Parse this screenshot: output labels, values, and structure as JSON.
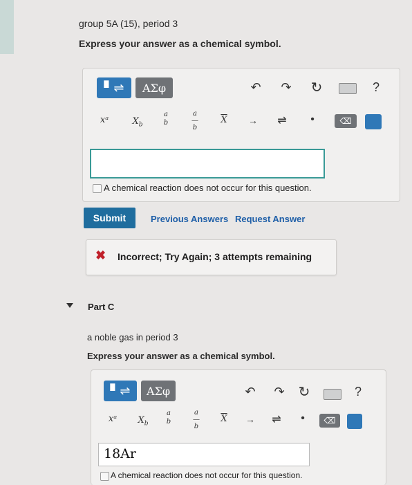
{
  "partB": {
    "prompt": "group 5A (15), period 3",
    "instruction": "Express your answer as a chemical symbol.",
    "toolbar": {
      "greek_label": "ΑΣφ",
      "help_label": "?",
      "symbols": [
        "xᵃ",
        "x_b",
        "a/b",
        "a/b",
        "x̄",
        "→",
        "⇌",
        "•"
      ]
    },
    "answer_value": "",
    "no_reaction_label": "A chemical reaction does not occur for this question.",
    "submit_label": "Submit",
    "previous_answers_label": "Previous Answers",
    "request_answer_label": "Request Answer",
    "feedback_text": "Incorrect; Try Again; 3 attempts remaining"
  },
  "partC": {
    "title": "Part C",
    "prompt": "a noble gas in period 3",
    "instruction": "Express your answer as a chemical symbol.",
    "toolbar": {
      "greek_label": "ΑΣφ",
      "help_label": "?"
    },
    "answer_value": "18Ar",
    "no_reaction_label": "A chemical reaction does not occur for this question."
  },
  "colors": {
    "accent_blue": "#2f78b7",
    "submit_blue": "#1f6d9e",
    "error_red": "#c0202a",
    "input_border": "#3a9a97"
  }
}
